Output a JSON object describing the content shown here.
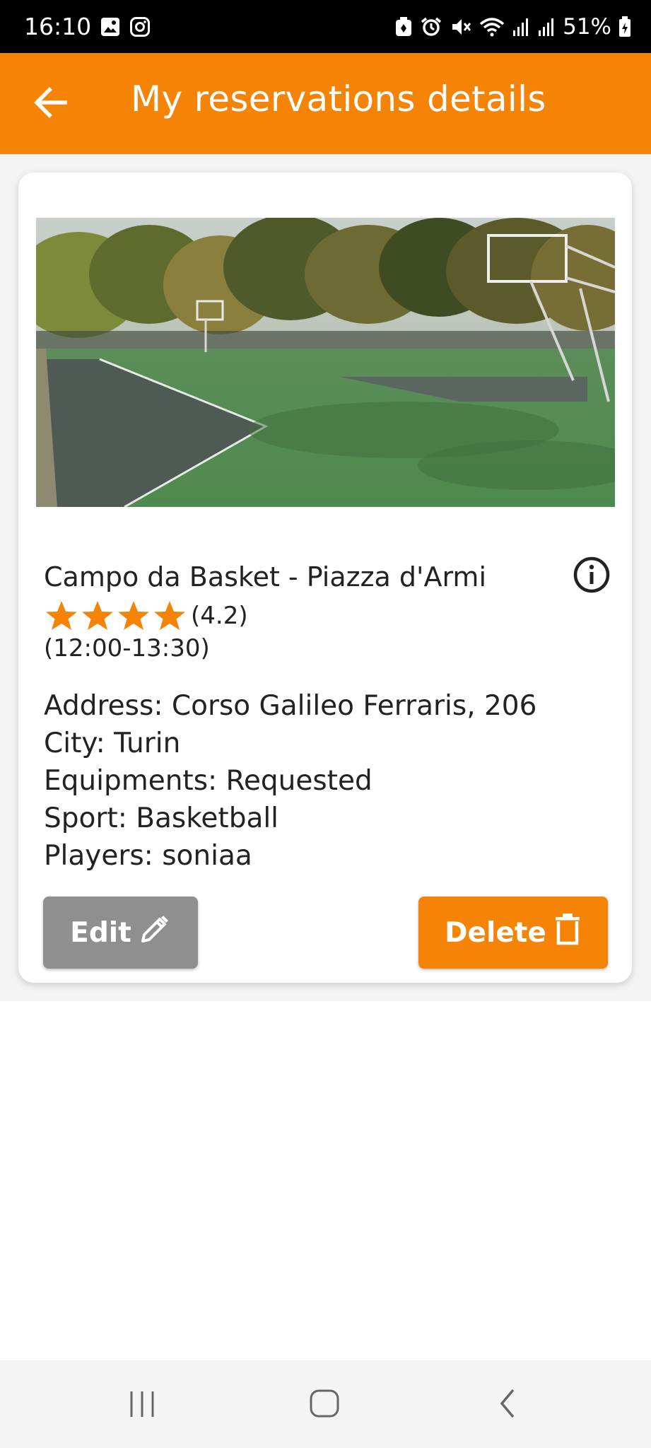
{
  "status_bar": {
    "time": "16:10",
    "battery": "51%",
    "left_icons": [
      "gallery-icon",
      "instagram-icon"
    ],
    "right_icons": [
      "battery-saver-icon",
      "alarm-icon",
      "mute-icon",
      "wifi-icon",
      "signal-icon",
      "signal-icon",
      "battery-icon"
    ]
  },
  "app_bar": {
    "title": "My reservations details",
    "back_icon": "arrow-left-icon",
    "color": "#f58306"
  },
  "reservation": {
    "name": "Campo da Basket - Piazza d'Armi",
    "rating_value": 4.2,
    "rating_text": "(4.2)",
    "stars_shown": 4,
    "time_range": "(12:00-13:30)",
    "address": "Address: Corso Galileo Ferraris, 206",
    "city": "City: Turin",
    "equipments": "Equipments: Requested",
    "sport": "Sport: Basketball",
    "players": "Players: soniaa",
    "image": "basketball-court-photo"
  },
  "actions": {
    "edit_label": "Edit",
    "edit_icon": "pencil-icon",
    "delete_label": "Delete",
    "delete_icon": "trash-icon",
    "edit_color": "#8f8f8f",
    "delete_color": "#f58306"
  },
  "nav_bar": {
    "buttons": [
      "recent-apps-icon",
      "home-icon",
      "back-chevron-icon"
    ]
  }
}
